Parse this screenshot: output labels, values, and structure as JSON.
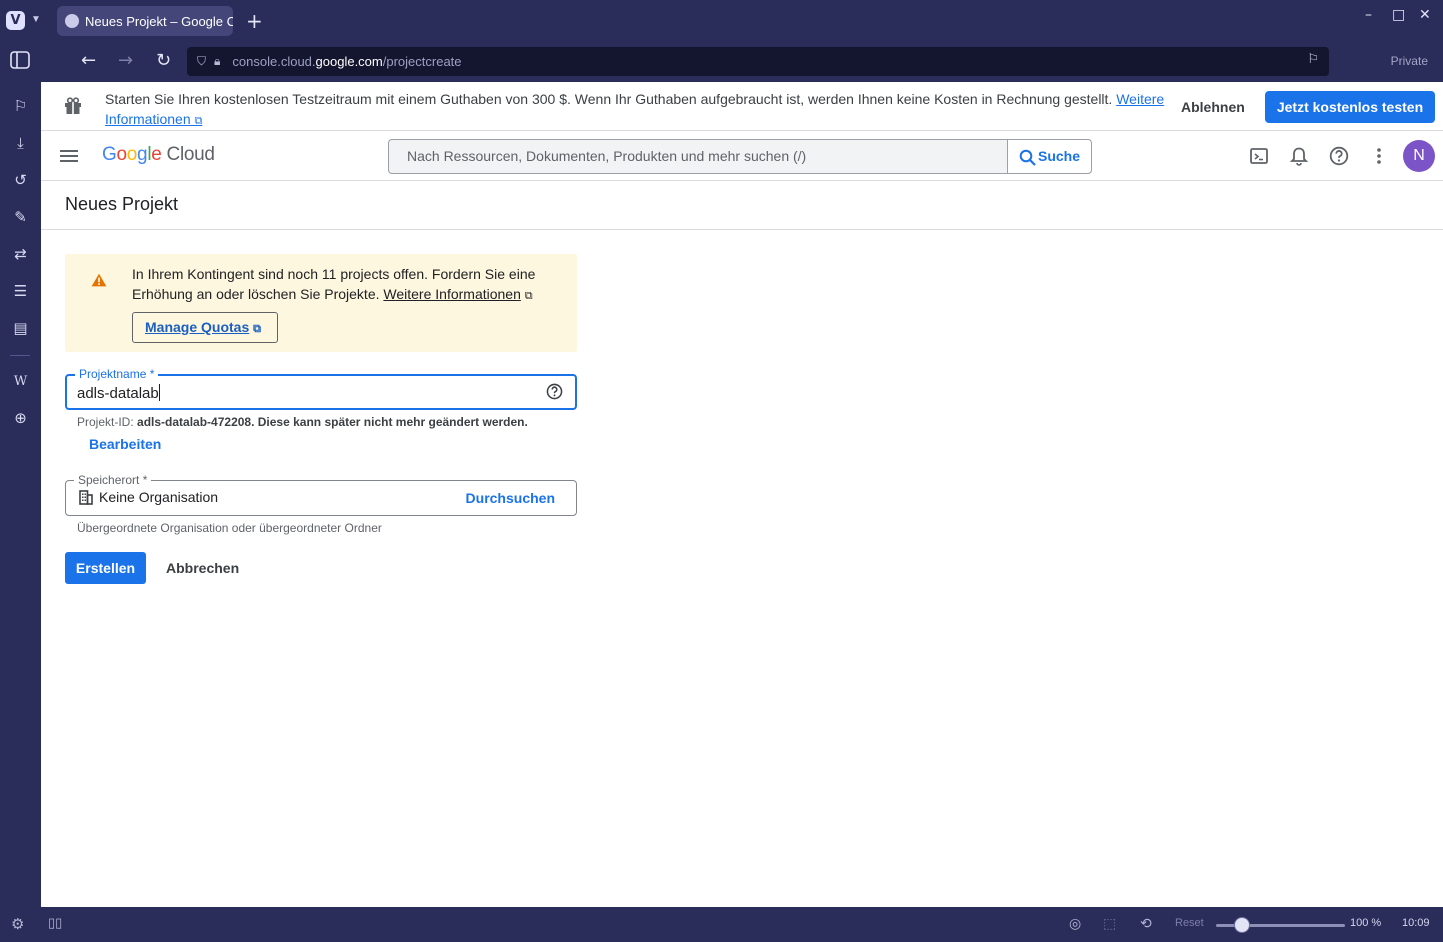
{
  "browser": {
    "tab_title": "Neues Projekt – Google Cl",
    "url_prefix": "console.cloud.",
    "url_domain": "google.com",
    "url_path": "/projectcreate",
    "private_label": "Private",
    "status": {
      "reset_label": "Reset",
      "zoom": "100 %",
      "clock": "10:09"
    }
  },
  "promo": {
    "text": "Starten Sie Ihren kostenlosen Testzeitraum mit einem Guthaben von 300 $. Wenn Ihr Guthaben aufgebraucht ist, werden Ihnen keine Kosten in Rechnung gestellt.",
    "link_part1": "Weitere",
    "link_part2": "Informationen",
    "decline_label": "Ablehnen",
    "try_label": "Jetzt kostenlos testen"
  },
  "header": {
    "logo_g": "G",
    "logo_o1": "o",
    "logo_o2": "o",
    "logo_g2": "g",
    "logo_l": "l",
    "logo_e": "e",
    "logo_cloud": "Cloud",
    "search_placeholder": "Nach Ressourcen, Dokumenten, Produkten und mehr suchen (/)",
    "search_button": "Suche",
    "avatar_initial": "N"
  },
  "page": {
    "title": "Neues Projekt"
  },
  "quota": {
    "text": "In Ihrem Kontingent sind noch 11 projects offen. Fordern Sie eine Erhöhung an oder löschen Sie Projekte.",
    "link": "Weitere Informationen",
    "button": "Manage Quotas"
  },
  "form": {
    "name_label": "Projektname *",
    "name_value": "adls-datalab",
    "id_prefix": "Projekt-ID:",
    "id_value": "adls-datalab-472208. Diese kann später nicht mehr geändert werden.",
    "edit_label": "Bearbeiten",
    "location_label": "Speicherort *",
    "location_value": "Keine Organisation",
    "browse_label": "Durchsuchen",
    "location_hint": "Übergeordnete Organisation oder übergeordneter Ordner",
    "create_label": "Erstellen",
    "cancel_label": "Abbrechen"
  },
  "colors": {
    "accent": "#1a73e8",
    "warning_bg": "#fef7e0",
    "warning_icon": "#e37400",
    "avatar": "#7b54c8",
    "browser_chrome": "#2a2c5a"
  }
}
